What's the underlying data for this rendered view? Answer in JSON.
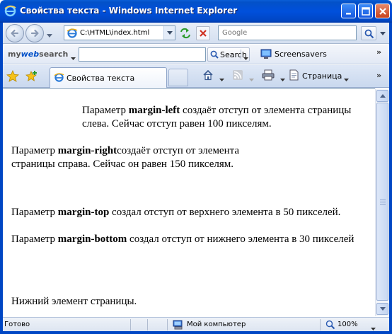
{
  "window": {
    "title": "Свойства текста - Windows Internet Explorer"
  },
  "address_bar": {
    "url": "C:\\HTML\\index.html",
    "search_placeholder": "Google"
  },
  "toolbar": {
    "logo_my": "my",
    "logo_web": "web",
    "logo_search": "search",
    "search_label": "Search",
    "screensavers_label": "Screensavers",
    "more": "»"
  },
  "tabs": {
    "active_label": "Свойства текста",
    "page_menu_label": "Страница",
    "more": "»"
  },
  "content": {
    "p1": {
      "before": "Параметр ",
      "bold": "margin-left",
      "after": " создаёт отступ от элемента страницы слева. Сейчас отступ равен 100 пикселям."
    },
    "p2": {
      "before": "Параметр ",
      "bold": "margin-right",
      "after": "создаёт отступ от элемента страницы справа. Сейчас он равен 150 пикселям."
    },
    "p3": {
      "before": "Параметр ",
      "bold": "margin-top",
      "after": " создал отступ от верхнего элемента в 50 пикселей."
    },
    "p4": {
      "before": "Параметр ",
      "bold": "margin-bottom",
      "after": " создал отступ от нижнего элемента в 30 пикселей"
    },
    "p5": "Нижний элемент страницы."
  },
  "statusbar": {
    "status": "Готово",
    "zone": "Мой компьютер",
    "zoom": "100%"
  },
  "colors": {
    "titlebar": "#0050dc",
    "frame": "#0046c4"
  }
}
